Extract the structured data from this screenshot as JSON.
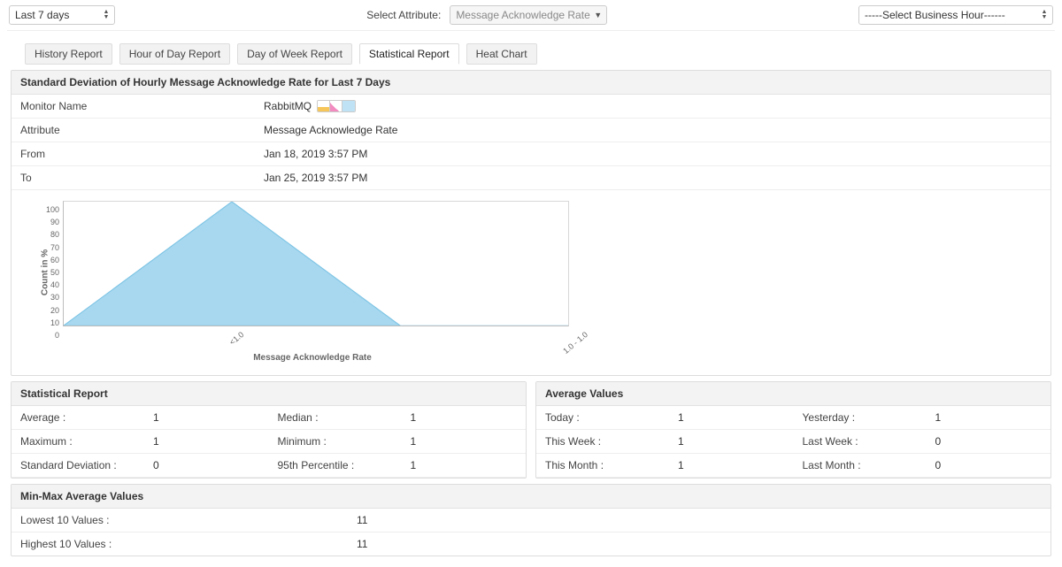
{
  "topControls": {
    "timeRange": "Last 7 days",
    "attributeLabel": "Select Attribute:",
    "attribute": "Message Acknowledge Rate",
    "businessHour": "-----Select Business Hour------"
  },
  "tabs": {
    "history": "History Report",
    "hourOfDay": "Hour of Day Report",
    "dayOfWeek": "Day of Week Report",
    "statistical": "Statistical Report",
    "heatChart": "Heat Chart"
  },
  "mainPanel": {
    "title": "Standard Deviation of Hourly Message Acknowledge Rate for Last 7 Days",
    "info": {
      "monitorNameLabel": "Monitor Name",
      "monitorName": "RabbitMQ",
      "attributeLabel": "Attribute",
      "attribute": "Message Acknowledge Rate",
      "fromLabel": "From",
      "from": "Jan 18, 2019 3:57 PM",
      "toLabel": "To",
      "to": "Jan 25, 2019 3:57 PM"
    }
  },
  "chart_data": {
    "type": "area",
    "ylabel": "Count in %",
    "xlabel": "Message Acknowledge Rate",
    "ylim": [
      0,
      100
    ],
    "y_ticks": [
      0,
      10,
      20,
      30,
      40,
      50,
      60,
      70,
      80,
      90,
      100
    ],
    "categories": [
      "",
      "<1.0",
      "",
      "1.0 - 1.0"
    ],
    "values": [
      0,
      100,
      0,
      0
    ],
    "area_color": "#a7d8ef"
  },
  "statReport": {
    "title": "Statistical Report",
    "rows": {
      "averageLabel": "Average :",
      "average": "1",
      "medianLabel": "Median :",
      "median": "1",
      "maximumLabel": "Maximum :",
      "maximum": "1",
      "minimumLabel": "Minimum :",
      "minimum": "1",
      "stdDevLabel": "Standard Deviation :",
      "stdDev": "0",
      "p95Label": "95th Percentile :",
      "p95": "1"
    }
  },
  "avgValues": {
    "title": "Average Values",
    "rows": {
      "todayLabel": "Today :",
      "today": "1",
      "yesterdayLabel": "Yesterday :",
      "yesterday": "1",
      "thisWeekLabel": "This Week :",
      "thisWeek": "1",
      "lastWeekLabel": "Last Week :",
      "lastWeek": "0",
      "thisMonthLabel": "This Month :",
      "thisMonth": "1",
      "lastMonthLabel": "Last Month :",
      "lastMonth": "0"
    }
  },
  "minMax": {
    "title": "Min-Max Average Values",
    "lowestLabel": "Lowest 10 Values :",
    "lowest": "11",
    "highestLabel": "Highest 10 Values :",
    "highest": "11"
  }
}
